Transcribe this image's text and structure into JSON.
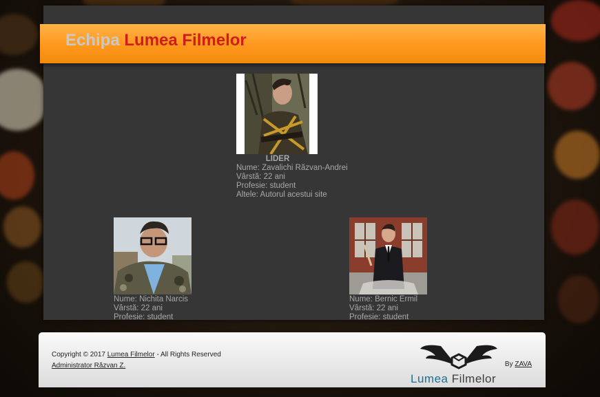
{
  "header": {
    "title_part1": "Echipa",
    "title_part2": "Lumea Filmelor"
  },
  "leader": {
    "label": "LIDER",
    "name": "Nume: Zavalichi Răzvan-Andrei",
    "age": "Vârstă: 22 ani",
    "profession": "Profesie: student",
    "other": "Altele: Autorul acestui site"
  },
  "members": [
    {
      "name": "Nume: Nichita Narcis",
      "age": "Vârstă: 22 ani",
      "profession": "Profesie: student"
    },
    {
      "name": "Nume: Bernic Ermil",
      "age": "Vârstă: 22 ani",
      "profession": "Profesie: student"
    }
  ],
  "footer": {
    "copyright_prefix": "Copyright © 2017",
    "site_link": "Lumea Filmelor",
    "copyright_suffix": "- All Rights Reserved",
    "admin_link": "Administrator Răzvan Z.",
    "by_label": "By",
    "by_link": "ZAVA",
    "logo_text_1": "Lumea",
    "logo_text_2": "Filmelor"
  },
  "colors": {
    "banner_orange": "#ff9a1f",
    "title_gray": "#c9c9c9",
    "title_red": "#d21b1b",
    "panel_bg": "#363636",
    "logo_blue": "#1e6f8f"
  }
}
